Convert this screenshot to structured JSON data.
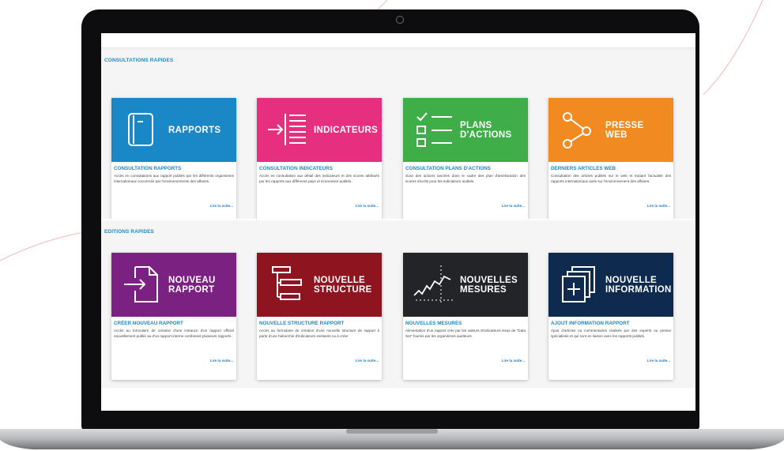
{
  "colors": {
    "rapports": "#1a87c6",
    "indicateurs": "#e6307f",
    "plans": "#3fae49",
    "presse": "#f18a21",
    "nouveau_rapport": "#7b2181",
    "nouvelle_structure": "#8e1420",
    "nouvelles_mesures": "#222428",
    "nouvelle_information": "#0e2b4f",
    "accent": "#1e8bc3"
  },
  "sections": {
    "consultations_title": "CONSULTATIONS RAPIDES",
    "editions_title": "EDITIONS RAPIDES"
  },
  "cards": {
    "rapports": {
      "icon": "document-icon",
      "label_l1": "RAPPORTS",
      "label_l2": "",
      "title": "CONSULTATION RAPPORTS",
      "desc": "Accès en consultations aux rapport publiés par les différents organismes internationaux concernés par l'environnements des affaires.",
      "more": "Lire la suite..."
    },
    "indicateurs": {
      "icon": "list-arrow-icon",
      "label_l1": "INDICATEURS",
      "label_l2": "",
      "title": "CONSULTATION INDICATEURS",
      "desc": "Accès en consultation aux détail des indicateurs et des scores attribués par les rapports aux différents pays et économies audités.",
      "more": "Lire la suite..."
    },
    "plans": {
      "icon": "checklist-icon",
      "label_l1": "PLANS",
      "label_l2": "D'ACTIONS",
      "title": "CONSULTATION PLANS D'ACTIONS",
      "desc": "Suivi des actions lancées dans le cadre des plan d'amélioration des scores inscrits pour les indicateurs audités.",
      "more": "Lire la suite..."
    },
    "presse": {
      "icon": "share-icon",
      "label_l1": "PRESSE",
      "label_l2": "WEB",
      "title": "DERNIERS ARTICLES WEB",
      "desc": "Consultation des articles publiés sur le web et traitant l'actualité des rapports internationaux axés sur l'environnement des affaires.",
      "more": "Lire la suite..."
    },
    "nouveau_rapport": {
      "icon": "file-import-icon",
      "label_l1": "NOUVEAU",
      "label_l2": "RAPPORT",
      "title": "CRÉER NOUVEAU RAPPORT",
      "desc": "Accès au formulaire de création d'une instance d'un rapport officiel nouvellement publié au d'un rapport interne combinant plusieurs rapports.",
      "more": "Lire la suite..."
    },
    "nouvelle_structure": {
      "icon": "hierarchy-icon",
      "label_l1": "NOUVELLE",
      "label_l2": "STRUCTURE",
      "title": "NOUVELLE STRUCTURE RAPPORT",
      "desc": "Accès au formulaire de création d'une nouvelle structure de rapport à partir d'une hiérarchie d'indicateurs existants ou à créer",
      "more": "Lire la suite..."
    },
    "nouvelles_mesures": {
      "icon": "trend-chart-icon",
      "label_l1": "NOUVELLES",
      "label_l2": "MESURES",
      "title": "NOUVELLES MESURES",
      "desc": "Alimentation d'un rapport crée par les valeurs d'indicateurs issus de \"Data Set\" fournis par les organismes auditeurs",
      "more": "Lire la suite..."
    },
    "nouvelle_information": {
      "icon": "stacked-add-icon",
      "label_l1": "NOUVELLE",
      "label_l2": "INFORMATION",
      "title": "AJOUT INFORMATION RAPPORT",
      "desc": "Ajout d'articles ou commentaires réalisés par des experts ou presse spécialisée et qui sont en liaison avec les rapports publiés.",
      "more": "Lire la suite..."
    }
  }
}
